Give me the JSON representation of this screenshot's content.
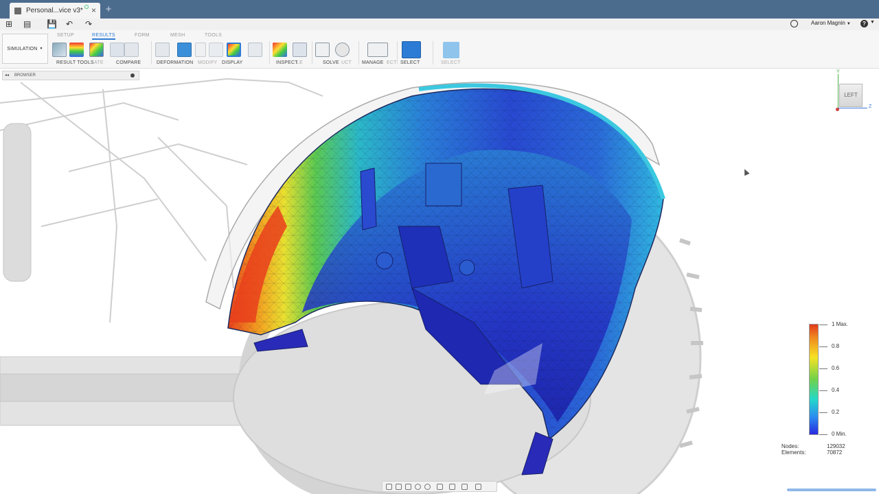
{
  "document": {
    "tab_title": "Personal...vice v3*",
    "new_tab_label": "+",
    "close_label": "×"
  },
  "quick_access": {
    "menu_label": "⊞",
    "file_label": "▤",
    "save_label": "💾",
    "undo_label": "↶",
    "redo_label": "↷"
  },
  "user": {
    "name": "Aaron Magnin",
    "help_label": "?"
  },
  "ribbon": {
    "workspace": "SIMULATION",
    "tabs": [
      "SETUP",
      "RESULTS",
      "FORM",
      "MESH",
      "TOOLS"
    ],
    "groups": [
      "RESULT TOOLS",
      "COMPARE",
      "DEFORMATION",
      "DISPLAY",
      "INSPECT",
      "SOLVE",
      "MANAGE",
      "SELECT",
      "SELECT"
    ],
    "ghost_labels": [
      "ATE",
      "MODIFY",
      "LE",
      "UCT",
      "ECT"
    ]
  },
  "browser": {
    "title": "BROWSER"
  },
  "viewcube": {
    "face": "LEFT",
    "axis_y": "Y",
    "axis_z": "Z"
  },
  "legend": {
    "max_label": "1 Max.",
    "ticks": [
      "0.8",
      "0.6",
      "0.4",
      "0.2"
    ],
    "min_label": "0 Min."
  },
  "stats": {
    "nodes_label": "Nodes:",
    "nodes_value": "129032",
    "elements_label": "Elements:",
    "elements_value": "70872"
  },
  "colors": {
    "title_bar": "#4c6c8e",
    "accent": "#2c7bd4",
    "legend_max": "#e23a1a",
    "legend_min": "#2a2ae0"
  },
  "icons": [
    "grid-menu-icon",
    "file-icon",
    "save-icon",
    "undo-icon",
    "redo-icon",
    "clock-icon",
    "help-icon"
  ]
}
